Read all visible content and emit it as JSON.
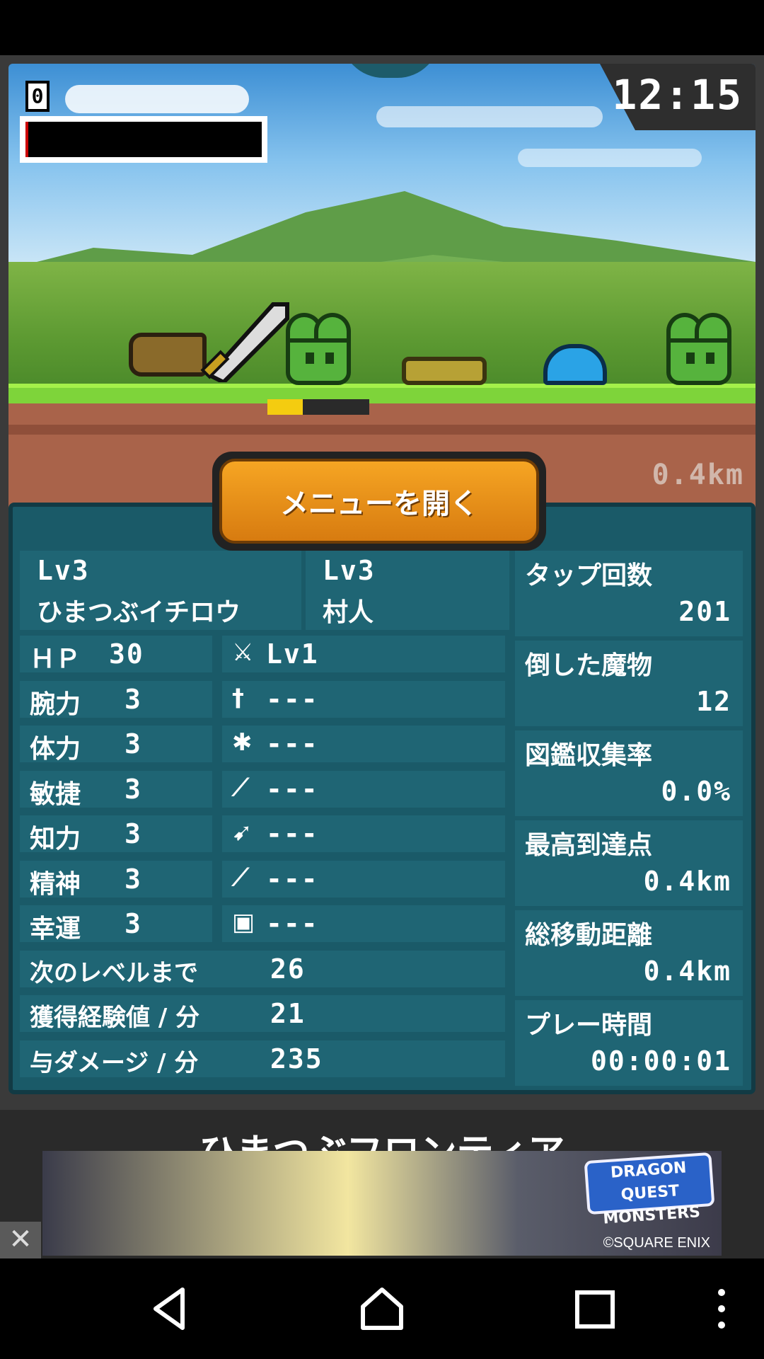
{
  "hud": {
    "score": "0",
    "clock": "12:15",
    "distance": "0.4km",
    "hero_hp_fraction": 0.35
  },
  "menu_button_label": "メニューを開く",
  "character": {
    "level": "Lv3",
    "name": "ひまつぶイチロウ",
    "job_level": "Lv3",
    "job": "村人"
  },
  "stats": [
    {
      "label": "ＨＰ",
      "value": "30"
    },
    {
      "label": "腕力",
      "value": "3"
    },
    {
      "label": "体力",
      "value": "3"
    },
    {
      "label": "敏捷",
      "value": "3"
    },
    {
      "label": "知力",
      "value": "3"
    },
    {
      "label": "精神",
      "value": "3"
    },
    {
      "label": "幸運",
      "value": "3"
    }
  ],
  "equipment": [
    {
      "icon": "sword-icon",
      "value": "Lv1"
    },
    {
      "icon": "dagger-icon",
      "value": "---"
    },
    {
      "icon": "armor-icon",
      "value": "---"
    },
    {
      "icon": "spear-icon",
      "value": "---"
    },
    {
      "icon": "bow-icon",
      "value": "---"
    },
    {
      "icon": "wand-icon",
      "value": "---"
    },
    {
      "icon": "shield-icon",
      "value": "---"
    }
  ],
  "progress": [
    {
      "label": "次のレベルまで",
      "value": "26"
    },
    {
      "label": "獲得経験値 / 分",
      "value": "21"
    },
    {
      "label": "与ダメージ / 分",
      "value": "235"
    }
  ],
  "records": [
    {
      "label": "タップ回数",
      "value": "201"
    },
    {
      "label": "倒した魔物",
      "value": "12"
    },
    {
      "label": "図鑑収集率",
      "value": "0.0%"
    },
    {
      "label": "最高到達点",
      "value": "0.4km"
    },
    {
      "label": "総移動距離",
      "value": "0.4km"
    },
    {
      "label": "プレー時間",
      "value": "00:00:01"
    }
  ],
  "ad": {
    "title": "ひまつぶフロンティア",
    "logo": "DRAGON QUEST MONSTERS",
    "copyright": "©SQUARE ENIX",
    "close": "✕"
  },
  "colors": {
    "panel": "#1a5a68",
    "menu_button": "#f6a523",
    "hp_bar": "#f4cc10"
  }
}
